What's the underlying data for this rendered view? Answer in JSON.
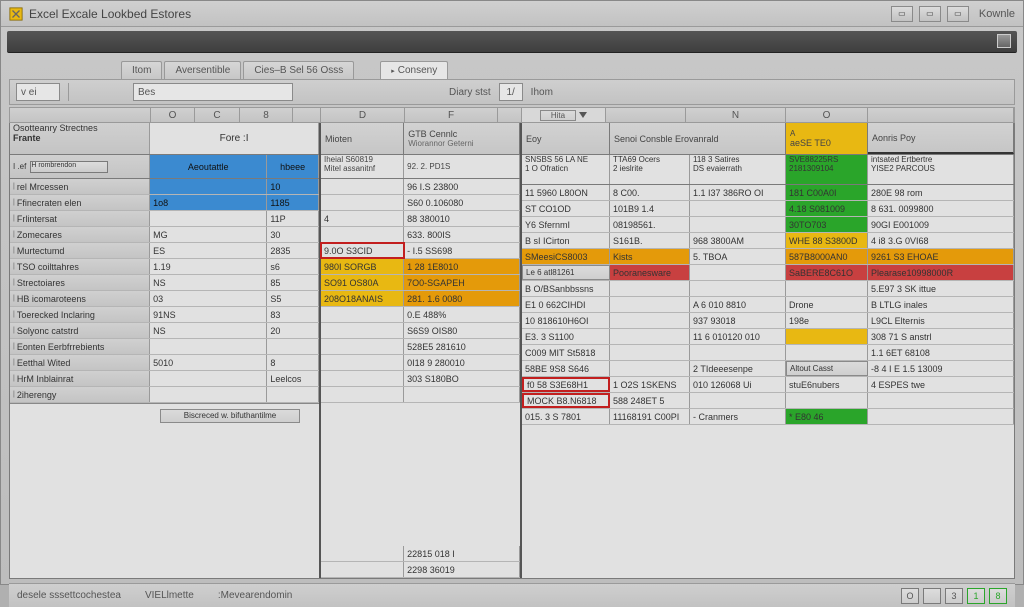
{
  "window": {
    "title": "Excel Excale Lookbed Estores",
    "help_label": "Kownle"
  },
  "tabs": {
    "items": [
      "Itom",
      "Aversentible",
      "Cies–B Sel 56 Osss",
      "Conseny"
    ],
    "selected_index": 3
  },
  "toolbar2": {
    "field1": "v ei",
    "field2": "Bes",
    "field3": "Diary stst",
    "field4": "Ihom",
    "toggle_label": "1/"
  },
  "colheads": [
    "O",
    "C",
    "8",
    "",
    "D",
    "F",
    "",
    "Hita",
    "",
    "N",
    "O",
    ""
  ],
  "left_headers": {
    "a_top": "Osotteanry",
    "a_sub": "Frante",
    "b_top": "Strectnes",
    "panel_name": "Fore :I"
  },
  "left_subhead": {
    "a": "I .ef",
    "a_btn": "H rombrendon",
    "b": "Aeoutattle",
    "c": "hbeee"
  },
  "left_rows": [
    {
      "label": "rel Mrcessen",
      "c1": "",
      "c2": "10"
    },
    {
      "label": "Ffinecraten elen",
      "c1": "1o8",
      "c2": "1185"
    },
    {
      "label": "Frlintersat",
      "c1": "",
      "c2": "11P"
    },
    {
      "label": "Zomecares",
      "c1": "MG",
      "c2": "30"
    },
    {
      "label": "Murtectumd",
      "c1": "ES",
      "c2": "2835"
    },
    {
      "label": "TSO coilttahres",
      "c1": "1.19",
      "c2": "s6"
    },
    {
      "label": "Strectoiares",
      "c1": "NS",
      "c2": "85"
    },
    {
      "label": "HB icomaroteens",
      "c1": "03",
      "c2": "S5"
    },
    {
      "label": "Toerecked Inclaring",
      "c1": "91NS",
      "c2": "83"
    },
    {
      "label": "Solyonc catstrd",
      "c1": "NS",
      "c2": "20"
    },
    {
      "label": "Eonten Eerbfrrebients",
      "c1": "",
      "c2": ""
    },
    {
      "label": "Eetthal Wited",
      "c1": "5010",
      "c2": "8"
    },
    {
      "label": "HrM Inblainrat",
      "c1": "",
      "c2": "Leelcos"
    },
    {
      "label": "2iherengy",
      "c1": "",
      "c2": ""
    }
  ],
  "left_footer": "Biscreced w. bifuthantilme",
  "mid_headers": {
    "d": "Mioten",
    "f_top": "GTB Cennlc",
    "f_sub": "Wiorannor Geterni"
  },
  "mid_subhead": {
    "d1": "Iheial S60819",
    "d2": "Mitel assanitnf",
    "f1": "92. 2. PD1S"
  },
  "mid_rows": [
    {
      "d": "",
      "f": "96 I.S 23800"
    },
    {
      "d": "",
      "f": "S60 0.106080"
    },
    {
      "d": "4",
      "f": "88 380010"
    },
    {
      "d": "",
      "f": "633. 800IS"
    },
    {
      "d_hl": "red",
      "d": "9.0O S3CID",
      "f": "- I.5 SS698"
    },
    {
      "d_hl": "orange",
      "d": "980I SORGB",
      "f": "1 28 1E8010",
      "f_hl": "orange"
    },
    {
      "d_hl": "orange",
      "d": "SO91 OS80A",
      "f": "7O0-SGAPEH",
      "f_hl": "orange"
    },
    {
      "d_hl": "orange",
      "d": "208O18ANAIS",
      "f": "281. 1.6 0080",
      "f_hl": "orange"
    },
    {
      "d": "",
      "f": "0.E 488%"
    },
    {
      "d": "",
      "f": "S6S9 OIS80"
    },
    {
      "d": "",
      "f": "528E5 281610"
    },
    {
      "d": "",
      "f": "0I18 9 280010"
    },
    {
      "d": "",
      "f": "303 S180BO"
    },
    {
      "d": "",
      "f": ""
    }
  ],
  "mid_bottom": [
    "22815 018 I",
    "2298 36019"
  ],
  "right_headers": {
    "h": "Eoy",
    "n": "Senoi Consble Erovanrald",
    "o_top": "A",
    "o_sub": "aeSE TE0",
    "p": "Aonris Poy"
  },
  "right_subhead": {
    "h1": "SNSBS 56 LA NE",
    "h2": "1 O Ofraticn",
    "n1": "TTA69 Ocers",
    "n2": "2 ieslrite",
    "n3": "118 3 Satires",
    "n4": "DS evaierrath",
    "o1_hl": "green",
    "o1": "SVE88225RS",
    "o2_hl": "green",
    "o2": "2181309104",
    "p1": "intsated Ertbertre",
    "p2": "YISE2 PARCOUS"
  },
  "right_rows": [
    {
      "h": "11 5960 L80ON",
      "n": "8 C00.",
      "n2": "1.1 I37 386RO OI",
      "o": "181 C00A0I",
      "o_hl": "green",
      "p": "280E 98 rom"
    },
    {
      "h": "ST CO1OD",
      "n": "101B9 1.4",
      "n2": "",
      "o": "4.18 S081009",
      "o_hl": "green",
      "p": "8 631. 0099800"
    },
    {
      "h": "Y6 SfernmI",
      "n": "08198561.",
      "n2": "",
      "o": "30TO703",
      "o_hl": "green",
      "p": "90GI E001009"
    },
    {
      "h": "B sI ICirton",
      "n": "S161B.",
      "n2": "968 3800AM",
      "o": "WHE 88 S3800D",
      "o_hl": "yellow",
      "p": "4 i8 3.G 0VI68"
    },
    {
      "h": "SMeesiCS8003",
      "h_hl": "orange",
      "n": "Kists",
      "n_hl": "orange",
      "n2": "5. TBOA",
      "o": "587B8000AN0",
      "o_hl": "orange",
      "p": "9261 S3 EHOAE",
      "p_hl": "orange"
    },
    {
      "h": "Le 6 atl81261",
      "h_hl": "emboss",
      "n": "Pooranesware",
      "n_hl": "red",
      "n2": "",
      "o": "SaBERE8C61O",
      "o_hl": "red",
      "p": "Plearase10998000R",
      "p_hl": "red"
    },
    {
      "h": "B O/BSanbbssns",
      "n": "",
      "n2": "",
      "o": "",
      "p": "5.E97 3 SK ittue"
    },
    {
      "h": "E1 0 662CIHDI",
      "n": "",
      "n2": "A 6 010 8810",
      "o": "Drone",
      "p": "B LTLG inales"
    },
    {
      "h": "10 818610H6OI",
      "n": "",
      "n2": "937 93018",
      "o": "198e",
      "p": "L9CL Elternis"
    },
    {
      "h": "E3. 3 S1100",
      "n": "",
      "n2": "11 6 010120 010",
      "o": "",
      "o_hl": "yellow",
      "p": "308 71 S anstrl"
    },
    {
      "h": "C009 MIT St5818",
      "n": "",
      "n2": "",
      "o": "",
      "p": "1.1 6ET 68108"
    },
    {
      "h": "58BE 9S8 S646",
      "n": "",
      "n2": "2 TIdeeesenpe",
      "o": "Altout Casst",
      "o_hl": "emboss",
      "p": "-8 4 I E 1.5 13009"
    },
    {
      "h": "f0 58 S3E68H1",
      "h_hl": "redbox",
      "n": "1 O2S 1SKENS",
      "n2": "010 126068 Ui",
      "o": "stuE6nubers",
      "p": "4 ESPES twe"
    },
    {
      "h": "MOCK B8.N6818",
      "h_hl": "redbox",
      "n": "588 248ET 5",
      "h2": "",
      "o": "",
      "p": ""
    },
    {
      "h": "015. 3 S 7801",
      "n": "11168191 C00PI",
      "n2": "- Cranmers",
      "o": "* E80 46",
      "o_hl": "green",
      "p": ""
    }
  ],
  "status": {
    "left": "desele sssettcochestea",
    "mid1": "VIELlmette",
    "mid2": ":Mevearendomin",
    "nums": [
      "O",
      "",
      "3",
      "1",
      "8"
    ]
  }
}
